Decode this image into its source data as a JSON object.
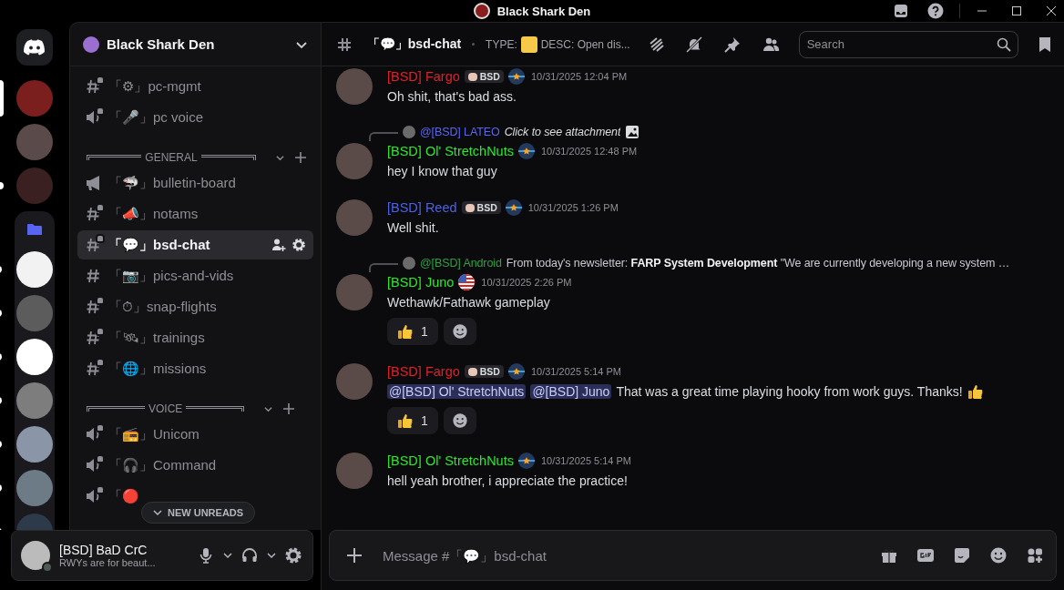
{
  "window": {
    "title": "Black Shark Den"
  },
  "servers": [
    {
      "kind": "home"
    },
    {
      "kind": "server",
      "selected": true,
      "unread": false,
      "color": "#7a1e1e"
    },
    {
      "kind": "server",
      "selected": false,
      "unread": false,
      "color": "#5a4a4a"
    },
    {
      "kind": "server",
      "selected": false,
      "unread": true,
      "color": "#3a2020"
    },
    {
      "kind": "folder"
    },
    {
      "kind": "server",
      "selected": false,
      "unread": true,
      "color": "#f2f2f2"
    },
    {
      "kind": "server",
      "selected": false,
      "unread": true,
      "color": "#5c5c5c"
    },
    {
      "kind": "server",
      "selected": false,
      "unread": true,
      "color": "#ffffff"
    },
    {
      "kind": "server",
      "selected": false,
      "unread": true,
      "color": "#7d7d7d"
    },
    {
      "kind": "server",
      "selected": false,
      "unread": true,
      "color": "#8a96a8"
    },
    {
      "kind": "server",
      "selected": false,
      "unread": true,
      "color": "#6c7b86"
    },
    {
      "kind": "server",
      "selected": false,
      "unread": true,
      "color": "#2c3a4a"
    }
  ],
  "sidebar": {
    "server_name": "Black Shark Den",
    "items": [
      {
        "kind": "text",
        "locked": true,
        "selected": false,
        "label": "「⚙」pc-mgmt"
      },
      {
        "kind": "voice",
        "locked": true,
        "selected": false,
        "label": "「🎤」pc voice"
      },
      {
        "kind": "category",
        "label": "GENERAL"
      },
      {
        "kind": "announcement",
        "locked": false,
        "selected": false,
        "label": "「🦈」bulletin-board"
      },
      {
        "kind": "text",
        "locked": true,
        "selected": false,
        "label": "「📣」notams"
      },
      {
        "kind": "text",
        "locked": true,
        "selected": true,
        "label": "「💬」bsd-chat"
      },
      {
        "kind": "text",
        "locked": false,
        "selected": false,
        "label": "「📷」pics-and-vids"
      },
      {
        "kind": "text",
        "locked": true,
        "selected": false,
        "label": "「⏱」snap-flights"
      },
      {
        "kind": "text",
        "locked": true,
        "selected": false,
        "label": "「🛰」trainings"
      },
      {
        "kind": "text",
        "locked": true,
        "selected": false,
        "label": "「🌐」missions"
      },
      {
        "kind": "category",
        "label": "VOICE"
      },
      {
        "kind": "voice",
        "locked": true,
        "selected": false,
        "label": "「📻」Unicom"
      },
      {
        "kind": "voice",
        "locked": true,
        "selected": false,
        "label": "「🎧」Command"
      },
      {
        "kind": "voice",
        "locked": true,
        "selected": false,
        "label": "「🔴"
      }
    ],
    "new_unreads": "NEW UNREADS"
  },
  "user": {
    "name": "[BSD] BaD CrC",
    "status": "RWYs are for beaut..."
  },
  "channel": {
    "name": "「💬」bsd-chat",
    "topic_type": "TYPE:",
    "topic_desc": "DESC: Open dis...",
    "search": {
      "placeholder": "Search"
    }
  },
  "messages": [
    {
      "author": "[BSD] Fargo",
      "color": "#e0202a",
      "tag": "BSD",
      "time": "10/31/2025 12:04 PM",
      "parts": [
        {
          "kind": "text",
          "text": "Oh shit, that's bad ass."
        }
      ]
    },
    {
      "reply": {
        "author": "@[BSD] LATEO",
        "color": "#5865f2",
        "text": "Click to see attachment",
        "kind": "attachment"
      },
      "author": "[BSD] Ol' StretchNuts",
      "color": "#2ee62e",
      "time": "10/31/2025 12:48 PM",
      "parts": [
        {
          "kind": "text",
          "text": "hey I know that guy"
        }
      ]
    },
    {
      "author": "[BSD] Reed",
      "color": "#4b62e8",
      "tag": "BSD",
      "time": "10/31/2025 1:26 PM",
      "parts": [
        {
          "kind": "text",
          "text": "Well shit."
        }
      ]
    },
    {
      "reply": {
        "author": "@[BSD] Android",
        "color": "#2ea043",
        "text": "From today's newsletter: **FARP System Development**  \"We are currently developing a new system …",
        "kind": "text"
      },
      "author": "[BSD] Juno",
      "color": "#2ee62e",
      "flag": true,
      "time": "10/31/2025 2:26 PM",
      "parts": [
        {
          "kind": "text",
          "text": "Wethawk/Fathawk gameplay"
        }
      ],
      "reactions": [
        {
          "count": "1"
        }
      ]
    },
    {
      "author": "[BSD] Fargo",
      "color": "#e0202a",
      "tag": "BSD",
      "time": "10/31/2025 5:14 PM",
      "parts": [
        {
          "kind": "mention",
          "text": "@[BSD] Ol' StretchNuts"
        },
        {
          "kind": "mention",
          "text": "@[BSD] Juno"
        },
        {
          "kind": "text",
          "text": "That was a great time playing hooky from work guys. Thanks!"
        },
        {
          "kind": "emoji"
        }
      ],
      "reactions": [
        {
          "count": "1"
        }
      ]
    },
    {
      "author": "[BSD] Ol' StretchNuts",
      "color": "#2ee62e",
      "time": "10/31/2025 5:14 PM",
      "parts": [
        {
          "kind": "text",
          "text": "hell yeah brother, i appreciate the practice!"
        }
      ]
    }
  ],
  "composer": {
    "placeholder": "Message #「💬」bsd-chat"
  }
}
